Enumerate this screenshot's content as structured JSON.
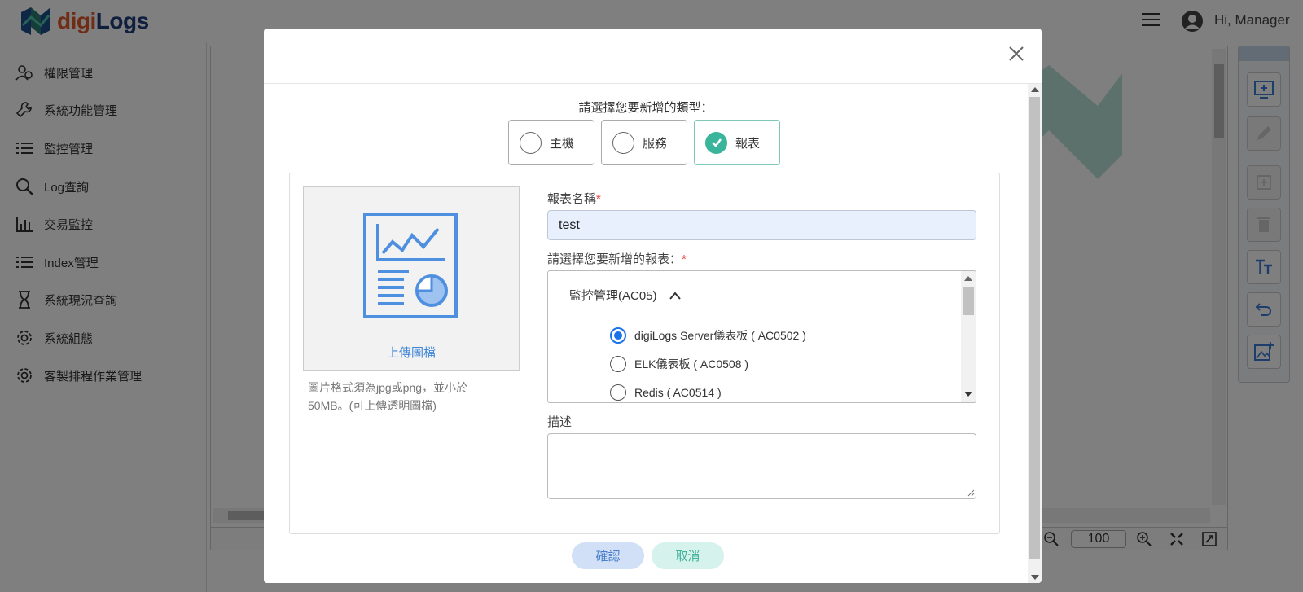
{
  "app": {
    "logo_prefix": "digi",
    "logo_suffix": "Logs",
    "user_greeting": "Hi, Manager",
    "zoom_value": "100"
  },
  "sidebar": {
    "items": [
      {
        "label": "權限管理",
        "icon": "user-group-icon"
      },
      {
        "label": "系統功能管理",
        "icon": "wrench-icon"
      },
      {
        "label": "監控管理",
        "icon": "list-icon"
      },
      {
        "label": "Log查詢",
        "icon": "search-icon"
      },
      {
        "label": "交易監控",
        "icon": "bar-chart-icon"
      },
      {
        "label": "Index管理",
        "icon": "list-icon"
      },
      {
        "label": "系統現況查詢",
        "icon": "hourglass-icon"
      },
      {
        "label": "系統組態",
        "icon": "gear-icon"
      },
      {
        "label": "客製排程作業管理",
        "icon": "gear-icon"
      }
    ]
  },
  "modal": {
    "type_prompt": "請選擇您要新增的類型：",
    "type_options": [
      {
        "label": "主機",
        "checked": false
      },
      {
        "label": "服務",
        "checked": false
      },
      {
        "label": "報表",
        "checked": true
      }
    ],
    "upload_label": "上傳圖檔",
    "upload_hint": "圖片格式須為jpg或png，並小於50MB。(可上傳透明圖檔)",
    "name_label": "報表名稱",
    "name_value": "test",
    "report_label": "請選擇您要新增的報表：",
    "required_mark": "*",
    "report_group": "監控管理(AC05)",
    "reports": [
      {
        "label": "digiLogs Server儀表板 ( AC0502 )",
        "checked": true
      },
      {
        "label": "ELK儀表板 ( AC0508 )",
        "checked": false
      },
      {
        "label": "Redis ( AC0514 )",
        "checked": false
      }
    ],
    "description_label": "描述",
    "description_value": "",
    "confirm_label": "確認",
    "cancel_label": "取消"
  },
  "colors": {
    "accent_teal": "#3ab49a",
    "accent_blue": "#1a73e8",
    "logo_orange": "#e0582a",
    "logo_navy": "#1f3f7a",
    "required_red": "#e53935"
  }
}
